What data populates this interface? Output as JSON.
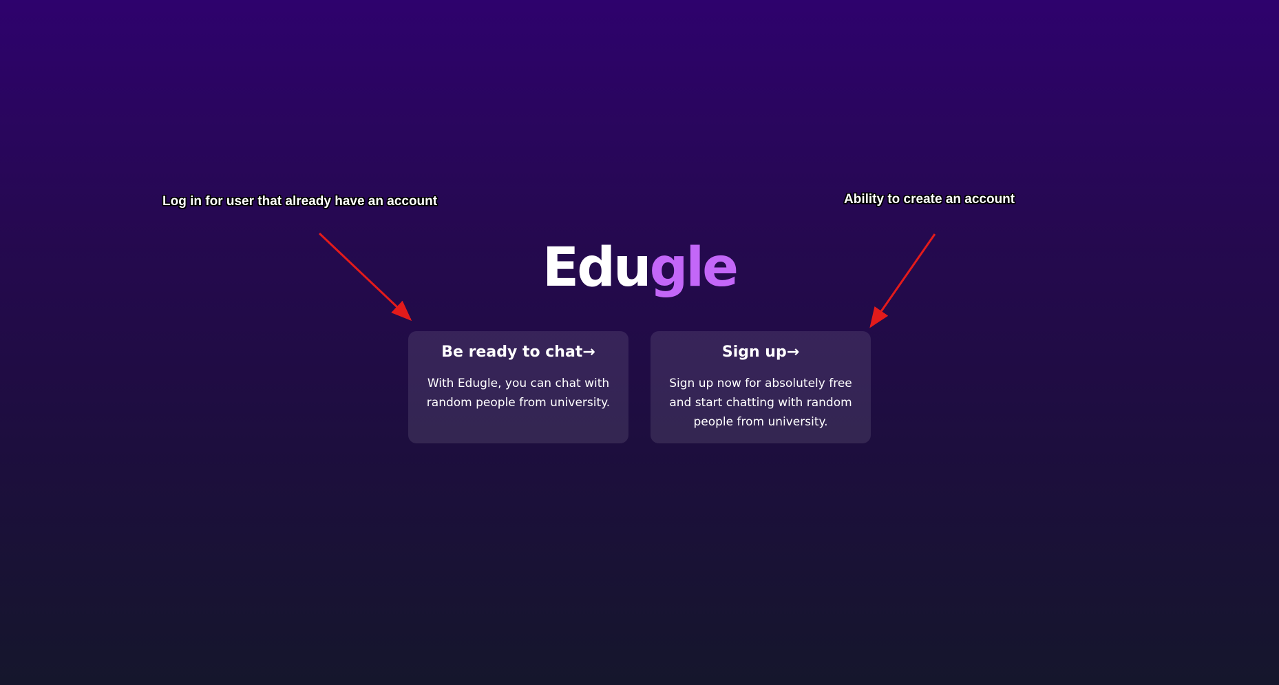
{
  "brand": {
    "name_part1": "Edu",
    "name_part2": "gle"
  },
  "cards": {
    "login": {
      "title": "Be ready to chat→",
      "description": "With Edugle, you can chat with random people from university."
    },
    "signup": {
      "title": "Sign up→",
      "description": "Sign up now for absolutely free and start chatting with random people from university."
    }
  },
  "annotations": {
    "left": "Log in for user that already have an account",
    "right": "Ability to create an account"
  },
  "colors": {
    "background_top": "#2e026d",
    "background_bottom": "#15162c",
    "brand_accent": "#c367f8",
    "annotation_arrow": "#e31b1b"
  }
}
